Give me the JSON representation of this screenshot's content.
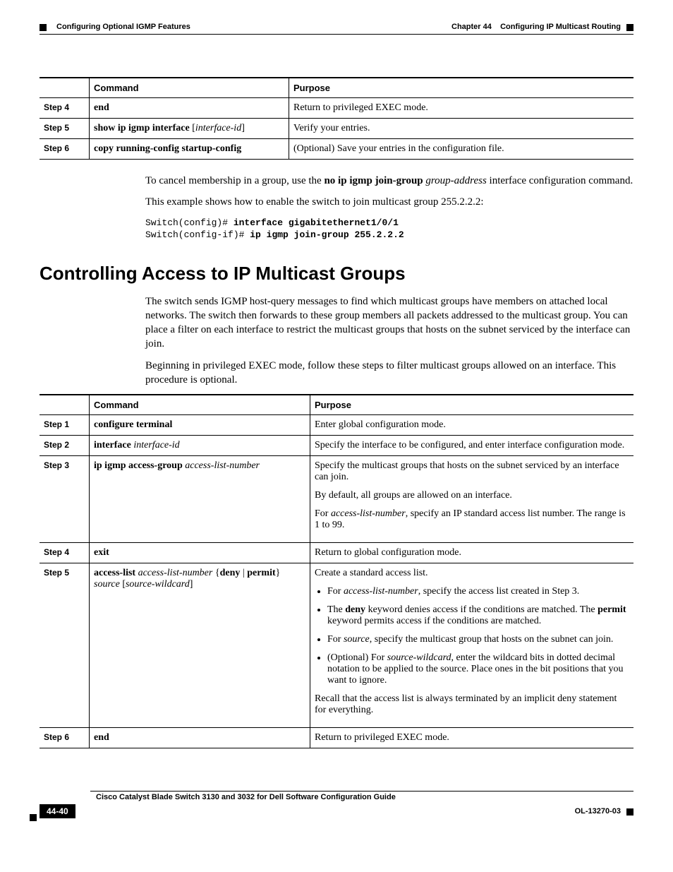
{
  "running_head": {
    "chapter_label": "Chapter 44",
    "chapter_title": "Configuring IP Multicast Routing",
    "section_title": "Configuring Optional IGMP Features"
  },
  "table1": {
    "headers": {
      "col1": "Command",
      "col2": "Purpose"
    },
    "rows": [
      {
        "step": "Step 4",
        "cmd_parts": [
          {
            "t": "end",
            "cls": "b"
          }
        ],
        "purpose": "Return to privileged EXEC mode."
      },
      {
        "step": "Step 5",
        "cmd_parts": [
          {
            "t": "show ip igmp interface",
            "cls": "b"
          },
          {
            "t": " [",
            "cls": ""
          },
          {
            "t": "interface-id",
            "cls": "i"
          },
          {
            "t": "]",
            "cls": ""
          }
        ],
        "purpose": "Verify your entries."
      },
      {
        "step": "Step 6",
        "cmd_parts": [
          {
            "t": "copy running-config startup-config",
            "cls": "b"
          }
        ],
        "purpose": "(Optional) Save your entries in the configuration file."
      }
    ]
  },
  "para_cancel": {
    "p1a": "To cancel membership in a group, use the ",
    "p1b": "no ip igmp join-group",
    "p1c": " ",
    "p1d": "group-address",
    "p1e": " interface configuration command."
  },
  "para_example": "This example shows how to enable the switch to join multicast group 255.2.2.2:",
  "code": {
    "l1a": "Switch(config)# ",
    "l1b": "interface gigabitethernet1/0/1",
    "l2a": "Switch(config-if)# ",
    "l2b": "ip igmp join-group 255.2.2.2"
  },
  "heading2": "Controlling Access to IP Multicast Groups",
  "para_intro1": "The switch sends IGMP host-query messages to find which multicast groups have members on attached local networks. The switch then forwards to these group members all packets addressed to the multicast group. You can place a filter on each interface to restrict the multicast groups that hosts on the subnet serviced by the interface can join.",
  "para_intro2": "Beginning in privileged EXEC mode, follow these steps to filter multicast groups allowed on an interface. This procedure is optional.",
  "table2": {
    "headers": {
      "col1": "Command",
      "col2": "Purpose"
    },
    "rows": {
      "r1": {
        "step": "Step 1",
        "cmd_parts": [
          {
            "t": "configure terminal",
            "cls": "b"
          }
        ],
        "purpose": "Enter global configuration mode."
      },
      "r2": {
        "step": "Step 2",
        "cmd_parts": [
          {
            "t": "interface",
            "cls": "b"
          },
          {
            "t": " ",
            "cls": ""
          },
          {
            "t": "interface-id",
            "cls": "i"
          }
        ],
        "purpose": "Specify the interface to be configured, and enter interface configuration mode."
      },
      "r3": {
        "step": "Step 3",
        "cmd_parts": [
          {
            "t": "ip igmp access-group",
            "cls": "b"
          },
          {
            "t": " ",
            "cls": ""
          },
          {
            "t": "access-list-number",
            "cls": "i"
          }
        ],
        "p1": "Specify the multicast groups that hosts on the subnet serviced by an interface can join.",
        "p2": "By default, all groups are allowed on an interface.",
        "p3a": "For ",
        "p3b": "access-list-number",
        "p3c": ", specify an IP standard access list number. The range is 1 to 99."
      },
      "r4": {
        "step": "Step 4",
        "cmd_parts": [
          {
            "t": "exit",
            "cls": "b"
          }
        ],
        "purpose": "Return to global configuration mode."
      },
      "r5": {
        "step": "Step 5",
        "cmd_parts": [
          {
            "t": "access-list",
            "cls": "b"
          },
          {
            "t": " ",
            "cls": ""
          },
          {
            "t": "access-list-number",
            "cls": "i"
          },
          {
            "t": " {",
            "cls": ""
          },
          {
            "t": "deny",
            "cls": "b"
          },
          {
            "t": " | ",
            "cls": ""
          },
          {
            "t": "permit",
            "cls": "b"
          },
          {
            "t": "} ",
            "cls": ""
          },
          {
            "t": "source",
            "cls": "i"
          },
          {
            "t": " [",
            "cls": ""
          },
          {
            "t": "source-wildcard",
            "cls": "i"
          },
          {
            "t": "]",
            "cls": ""
          }
        ],
        "intro": "Create a standard access list.",
        "b1a": "For ",
        "b1b": "access-list-number",
        "b1c": ", specify the access list created in Step 3.",
        "b2a": "The ",
        "b2b": "deny",
        "b2c": " keyword denies access if the conditions are matched. The ",
        "b2d": "permit",
        "b2e": " keyword permits access if the conditions are matched.",
        "b3a": "For ",
        "b3b": "source",
        "b3c": ", specify the multicast group that hosts on the subnet can join.",
        "b4a": "(Optional) For ",
        "b4b": "source-wildcard",
        "b4c": ", enter the wildcard bits in dotted decimal notation to be applied to the source. Place ones in the bit positions that you want to ignore.",
        "recall": "Recall that the access list is always terminated by an implicit deny statement for everything."
      },
      "r6": {
        "step": "Step 6",
        "cmd_parts": [
          {
            "t": "end",
            "cls": "b"
          }
        ],
        "purpose": "Return to privileged EXEC mode."
      }
    }
  },
  "footer": {
    "book_title": "Cisco Catalyst Blade Switch 3130 and 3032 for Dell Software Configuration Guide",
    "page_num": "44-40",
    "doc_id": "OL-13270-03"
  }
}
